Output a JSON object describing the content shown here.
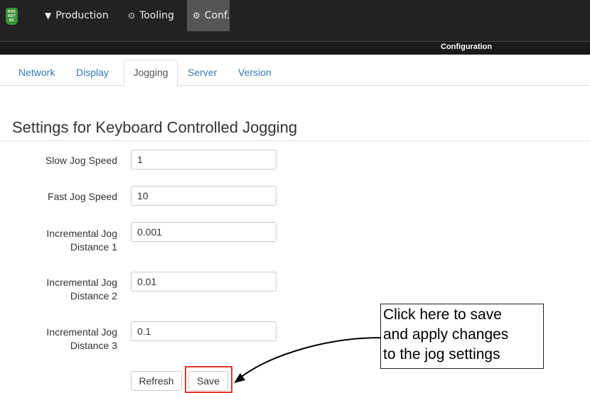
{
  "nav": {
    "logo_text": "POCKET NC",
    "items": [
      {
        "label": "Production",
        "icon": "filter-icon"
      },
      {
        "label": "Tooling",
        "icon": "play-circle-icon"
      },
      {
        "label": "Conf.",
        "icon": "gears-icon"
      }
    ]
  },
  "section_title": "Configuration",
  "tabs": [
    {
      "label": "Network",
      "active": false
    },
    {
      "label": "Display",
      "active": false
    },
    {
      "label": "Jogging",
      "active": true
    },
    {
      "label": "Server",
      "active": false
    },
    {
      "label": "Version",
      "active": false
    }
  ],
  "heading": "Settings for Keyboard Controlled Jogging",
  "fields": [
    {
      "label_lines": [
        "Slow Jog Speed"
      ],
      "value": "1"
    },
    {
      "label_lines": [
        "Fast Jog Speed"
      ],
      "value": "10"
    },
    {
      "label_lines": [
        "Incremental Jog",
        "Distance 1"
      ],
      "value": "0.001"
    },
    {
      "label_lines": [
        "Incremental Jog",
        "Distance 2"
      ],
      "value": "0.01"
    },
    {
      "label_lines": [
        "Incremental Jog",
        "Distance 3"
      ],
      "value": "0.1"
    }
  ],
  "buttons": {
    "refresh": "Refresh",
    "save": "Save"
  },
  "callout": {
    "lines": [
      "Click here to save",
      "and apply changes",
      "to the jog settings"
    ]
  },
  "colors": {
    "navbar": "#222222",
    "active_nav": "#555555",
    "link": "#337ab7",
    "highlight": "#e0392b"
  }
}
